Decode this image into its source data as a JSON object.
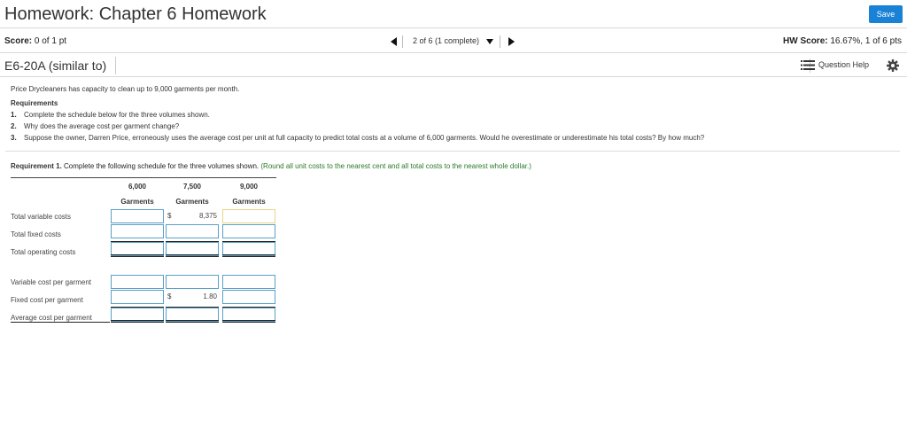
{
  "header": {
    "title": "Homework: Chapter 6 Homework",
    "save_label": "Save"
  },
  "score_bar": {
    "score_label": "Score:",
    "score_value": "0 of 1 pt",
    "nav_text": "2 of 6 (1 complete)",
    "hw_score_label": "HW Score:",
    "hw_score_value": "16.67%, 1 of 6 pts"
  },
  "question": {
    "title": "E6-20A (similar to)",
    "help_label": "Question Help"
  },
  "content": {
    "intro": "Price Drycleaners has capacity to clean up to 9,000 garments per month.",
    "req_head": "Requirements",
    "requirements": [
      {
        "num": "1.",
        "text": "Complete the schedule below for the three volumes shown."
      },
      {
        "num": "2.",
        "text": "Why does the average cost per garment change?"
      },
      {
        "num": "3.",
        "text": "Suppose the owner, Darren Price, erroneously uses the average cost per unit at full capacity to predict total costs at a volume of 6,000 garments. Would he overestimate or underestimate his total costs? By how much?"
      }
    ],
    "req1_label": "Requirement 1.",
    "req1_text": "Complete the following schedule for the three volumes shown.",
    "req1_instr": "(Round all unit costs to the nearest cent and all total costs to the nearest whole dollar.)"
  },
  "schedule": {
    "columns": [
      {
        "volume": "6,000",
        "unit": "Garments"
      },
      {
        "volume": "7,500",
        "unit": "Garments"
      },
      {
        "volume": "9,000",
        "unit": "Garments"
      }
    ],
    "rows": {
      "total_variable": "Total variable costs",
      "total_fixed": "Total fixed costs",
      "total_operating": "Total operating costs",
      "variable_per": "Variable cost per garment",
      "fixed_per": "Fixed cost per garment",
      "average_per": "Average cost per garment"
    },
    "given": {
      "tvc_7500_symbol": "$",
      "tvc_7500": "8,375",
      "fixed_per_7500_symbol": "$",
      "fixed_per_7500": "1.80"
    }
  },
  "colors": {
    "accent": "#1a82d6",
    "instruction": "#2a7a2a",
    "field_border": "#5aa0c8",
    "active_field": "#e8d58a"
  }
}
